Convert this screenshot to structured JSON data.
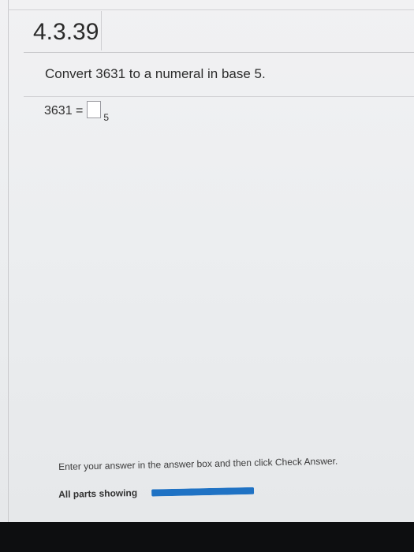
{
  "header": {
    "problem_number": "4.3.39"
  },
  "question": {
    "text": "Convert 3631 to a numeral in base 5.",
    "equation_lhs": "3631 =",
    "answer_value": "",
    "base_subscript": "5"
  },
  "footer": {
    "instructions": "Enter your answer in the answer box and then click Check Answer.",
    "parts_label": "All parts showing",
    "progress_fraction": 1.0
  },
  "colors": {
    "progress_fill": "#1f72c4",
    "background": "#eceef0",
    "bottom_bezel": "#0d0e10"
  }
}
